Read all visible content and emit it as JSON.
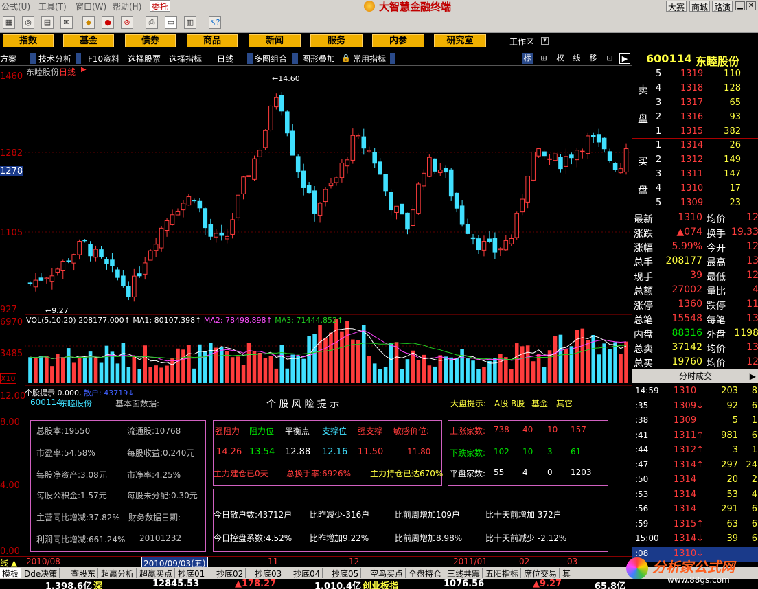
{
  "menubar": {
    "items": [
      "公式(U)",
      "工具(T)",
      "窗口(W)",
      "帮助(H)"
    ],
    "entrust": "委托",
    "title": "大智慧金融终端",
    "right_btns": [
      "大赛",
      "商城",
      "路演"
    ]
  },
  "nav": {
    "buttons": [
      "指数",
      "基金",
      "债券",
      "商品",
      "新闻",
      "服务",
      "内参",
      "研究室"
    ],
    "workarea": "工作区"
  },
  "tabs": {
    "items": [
      "方案",
      "技术分析",
      "F10资料",
      "选择股票",
      "选择指标",
      "日线",
      "多图组合",
      "图形叠加",
      "常用指标"
    ],
    "right_icons": [
      "标",
      "⊞",
      "权",
      "线",
      "移",
      "⊡",
      "▶"
    ]
  },
  "chart": {
    "stock_title": "东睦股份",
    "period": "日线",
    "y_labels": [
      "1460",
      "1282",
      "1278",
      "1105",
      "927"
    ],
    "high_label": "14.60",
    "low_label": "9.27",
    "vol_header": {
      "vol": "VOL(5,10,20)",
      "vol_val": "208177.000↑",
      "ma1": "MA1: 80107.398↑",
      "ma2": "MA2: 78498.898↑",
      "ma3": "MA3: 71444.852↑"
    },
    "vol_y_labels": [
      "6970",
      "3485",
      "X10"
    ],
    "ind_header": {
      "label": "个股提示",
      "val": "0.000,",
      "acc": "散户: 43719↓"
    },
    "ind_y": [
      "12.00",
      "8.00",
      "4.00",
      "0.00"
    ]
  },
  "info": {
    "code": "600114",
    "name": "东睦股份",
    "basic": "基本面数据:",
    "risk": "个 股 风 险 提 示",
    "market": "大盘提示:",
    "ab": "A股 B股",
    "fund": "基金",
    "other": "其它",
    "fin": [
      "总股本:19550",
      "流通股:10768",
      "市盈率:54.58%",
      "每股收益:0.240元",
      "每股净资产:3.08元",
      "市净率:4.25%",
      "每股公积金:1.57元",
      "每股未分配:0.30元",
      "主营同比增减:37.82%",
      "财务数据日期:",
      "利润同比增减:661.24%",
      "20101232"
    ],
    "pressure_heads": [
      "强阻力",
      "阻力位",
      "平衡点",
      "支撑位",
      "强支撑",
      "敏感价位:"
    ],
    "pressure_vals": [
      "14.26",
      "13.54",
      "12.88",
      "12.16",
      "11.50",
      "11.80"
    ],
    "pressure_notes": [
      "主力建仓已0天",
      "总换手率:6926%",
      "主力持仓已达670%"
    ],
    "breadth": [
      [
        "上涨家数:",
        "738",
        "40",
        "10",
        "157"
      ],
      [
        "下跌家数:",
        "102",
        "10",
        "3",
        "61"
      ],
      [
        "平盘家数:",
        "55",
        "4",
        "0",
        "1203"
      ]
    ],
    "retail": [
      "今日散户数:43712户",
      "比昨减少-316户",
      "比前周增加109户",
      "比十天前增加 372户",
      "今日控盘系数:4.52%",
      "比昨增加9.22%",
      "比前周增加8.98%",
      "比十天前减少 -2.12%"
    ]
  },
  "quote": {
    "code": "600114",
    "name": "东睦股份",
    "sell_label": [
      "卖",
      "盘"
    ],
    "buy_label": [
      "买",
      "盘"
    ],
    "asks": [
      [
        "5",
        "1319",
        "110"
      ],
      [
        "4",
        "1318",
        "128"
      ],
      [
        "3",
        "1317",
        "65"
      ],
      [
        "2",
        "1316",
        "93"
      ],
      [
        "1",
        "1315",
        "382"
      ]
    ],
    "bids": [
      [
        "1",
        "1314",
        "26"
      ],
      [
        "2",
        "1312",
        "149"
      ],
      [
        "3",
        "1311",
        "147"
      ],
      [
        "4",
        "1310",
        "17"
      ],
      [
        "5",
        "1309",
        "23"
      ]
    ],
    "stats": [
      [
        "最新",
        "1310",
        "均价",
        "12"
      ],
      [
        "涨跌",
        "▲074",
        "换手",
        "19.33"
      ],
      [
        "涨幅",
        "5.99%",
        "今开",
        "12"
      ],
      [
        "总手",
        "208177",
        "最高",
        "13"
      ],
      [
        "现手",
        "39",
        "最低",
        "12"
      ],
      [
        "总额",
        "27002",
        "量比",
        "4"
      ],
      [
        "涨停",
        "1360",
        "跌停",
        "11"
      ],
      [
        "总笔",
        "15548",
        "每笔",
        "13"
      ],
      [
        "内盘",
        "88316",
        "外盘",
        "1198"
      ],
      [
        "总卖",
        "37142",
        "均价",
        "13"
      ],
      [
        "总买",
        "19760",
        "均价",
        "12"
      ]
    ],
    "ticks_title": "分时成交",
    "ticks": [
      [
        "14:59",
        "1310",
        "203",
        "8"
      ],
      [
        ":35",
        "1309↓",
        "92",
        "6"
      ],
      [
        ":38",
        "1309",
        "5",
        "1"
      ],
      [
        ":41",
        "1311↑",
        "981",
        "6"
      ],
      [
        ":44",
        "1312↑",
        "3",
        "1"
      ],
      [
        ":47",
        "1314↑",
        "297",
        "24"
      ],
      [
        ":50",
        "1314",
        "20",
        "2"
      ],
      [
        ":53",
        "1314",
        "53",
        "4"
      ],
      [
        ":56",
        "1314",
        "291",
        "6"
      ],
      [
        ":59",
        "1315↑",
        "63",
        "6"
      ],
      [
        "15:00",
        "1314↓",
        "39",
        "6"
      ],
      [
        ":08",
        "1310↓",
        "",
        ""
      ]
    ]
  },
  "datebar": {
    "labels": [
      "2010/08",
      "2010/09/03(五)",
      "11",
      "12",
      "2011/01",
      "02",
      "03"
    ],
    "ind": "线"
  },
  "bottomtabs": [
    "模板",
    "Dde决策",
    "查股东",
    "超赢分析",
    "超赢买点",
    "抄底01",
    "抄底02",
    "抄底03",
    "抄底04",
    "抄底05",
    "空鸟买点",
    "全盘持仓",
    "三线共震",
    "五阳指标",
    "席位交易",
    "其"
  ],
  "status": [
    [
      "1,398.6亿",
      "white"
    ],
    [
      "深",
      "yellow"
    ],
    [
      "12845.53",
      "white"
    ],
    [
      "▲178.27",
      "red"
    ],
    [
      "1,010.4亿",
      "white"
    ],
    [
      "创业板指",
      "yellow"
    ],
    [
      "1076.56",
      "white"
    ],
    [
      "▲9.27",
      "red"
    ],
    [
      "65.8亿",
      "white"
    ]
  ],
  "watermark": {
    "text": "分析家公式网",
    "url": "www.88gs.com"
  }
}
